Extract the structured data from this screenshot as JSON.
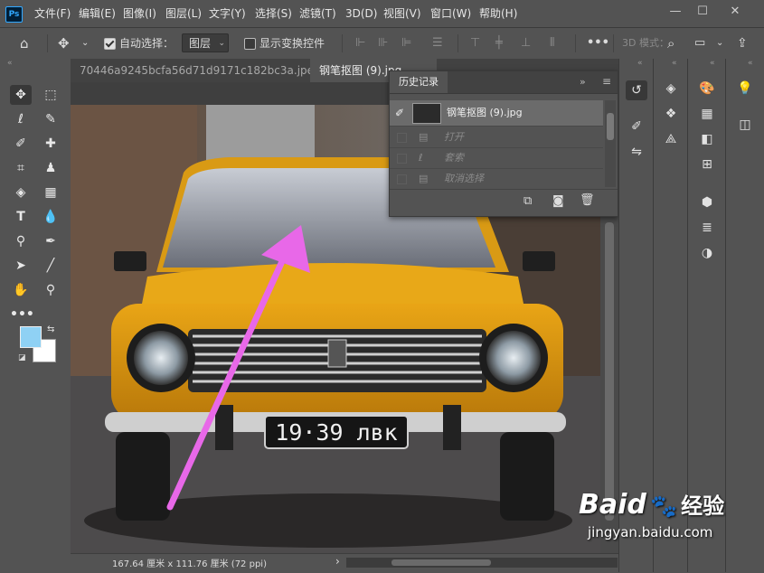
{
  "app": {
    "logo": "Ps"
  },
  "menu": [
    "文件(F)",
    "编辑(E)",
    "图像(I)",
    "图层(L)",
    "文字(Y)",
    "选择(S)",
    "滤镜(T)",
    "3D(D)",
    "视图(V)",
    "窗口(W)",
    "帮助(H)"
  ],
  "window_controls": {
    "minimize": "—",
    "maximize": "☐",
    "close": "✕"
  },
  "options_bar": {
    "auto_select_label": "自动选择：",
    "auto_select_checked": true,
    "auto_select_target": "图层",
    "show_transform_label": "显示变换控件",
    "show_transform_checked": false,
    "three_d_mode_label": "3D 模式：",
    "more": "•••"
  },
  "tabs": [
    {
      "label": "70446a9245bcfa56d71d9171c182bc3a.jpeg",
      "active": false,
      "close": "×"
    },
    {
      "label": "钢笔抠图 (9).jpg",
      "active": true,
      "close": "×"
    }
  ],
  "history_panel": {
    "title": "历史记录",
    "snapshot": "钢笔抠图 (9).jpg",
    "states": [
      "打开",
      "套索",
      "取消选择"
    ]
  },
  "status_bar": {
    "doc_info": "167.64 厘米 x 111.76 厘米 (72 ppi)",
    "arrow": "›"
  },
  "colors": {
    "foreground": "#8fd1f4",
    "background": "#ffffff",
    "accent_arrow": "#e868e8"
  },
  "canvas_image": {
    "plate": "19·39 лвк"
  },
  "watermark": {
    "brand": "Baid",
    "brand2": "经验",
    "url": "jingyan.baidu.com"
  }
}
